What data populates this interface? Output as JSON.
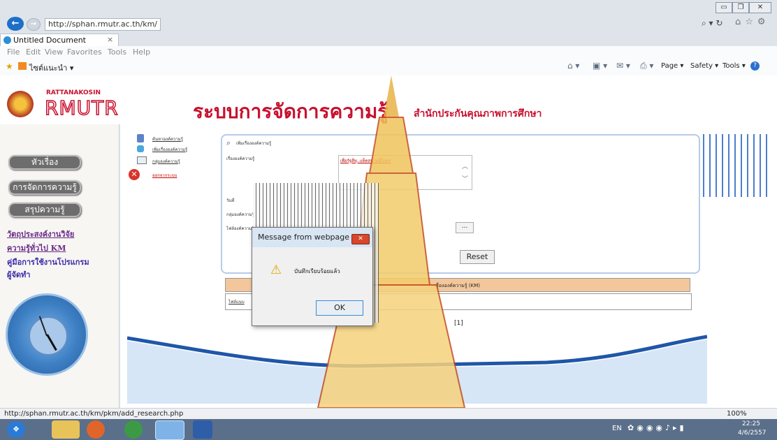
{
  "browser": {
    "address": "http://sphan.rmutr.ac.th/km/",
    "tab_title": "Untitled Document",
    "tab_close": "×",
    "menu": [
      "File",
      "Edit",
      "View",
      "Favorites",
      "Tools",
      "Help"
    ],
    "favorites_label": "ไซต์แนะนำ ▾",
    "toolbar_right": [
      "Page ▾",
      "Safety ▾",
      "Tools ▾"
    ],
    "search_glyphs": "⌕ ▾ ↻"
  },
  "site": {
    "brand_top": "RATTANAKOSIN",
    "brand_logo": "RMUTR",
    "title": "ระบบการจัดการความรู้",
    "subtitle": "สำนักประกันคุณภาพการศึกษา"
  },
  "sidebar": {
    "buttons": [
      "หัวเรื่อง",
      "การจัดการความรู้",
      "สรุปความรู้"
    ],
    "links": [
      "วัตถุประสงค์งานวิจัย",
      "ความรู้ทั่วไป KM",
      "คู่มือการใช้งานโปรแกรม",
      "ผู้จัดทำ"
    ]
  },
  "content_menu": {
    "items": [
      "ค้นหาองค์ความรู้",
      "เพิ่มเรื่ององค์ความรู้",
      "กลุ่มองค์ความรู้",
      "ออกจากระบบ"
    ]
  },
  "form": {
    "heading": "เพิ่มเรื่ององค์ความรู้",
    "label_topic": "เรื่ององค์ความรู้",
    "topic_value": "เพื่อรัฐสีทุ..แท็คสนามดีโกลฯ",
    "label_date": "วันที่",
    "label_group": "กลุ่มองค์ความรู้",
    "label_file": "ไฟล์องค์ความรู้",
    "browse": "...",
    "reset": "Reset"
  },
  "table": {
    "header": "เรื่ององค์ความรู้ (KM)",
    "row_link": "ไฟล์แนบ",
    "pager": "[1]"
  },
  "dialog": {
    "title": "Message from webpage",
    "message": "บันทึกเรียบร้อยแล้ว",
    "ok": "OK",
    "close": "✕"
  },
  "status": {
    "url": "http://sphan.rmutr.ac.th/km/pkm/add_research.php",
    "zoom": "100%"
  },
  "taskbar": {
    "lang": "EN",
    "time": "22:25",
    "date": "4/6/2557"
  },
  "colors": {
    "accent_red": "#c8102e",
    "table_header": "#f3c79b",
    "page_bg": "#f4f3f1"
  }
}
